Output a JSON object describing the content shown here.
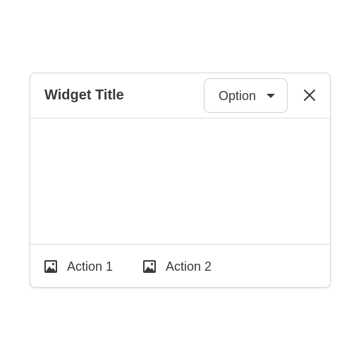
{
  "widget": {
    "title": "Widget Title",
    "option_label": "Option",
    "option_icon": "caret-down-icon",
    "close_icon": "close-icon",
    "actions": [
      {
        "label": "Action 1",
        "icon": "image-icon"
      },
      {
        "label": "Action 2",
        "icon": "image-icon"
      }
    ]
  },
  "colors": {
    "text": "#3a3a3a",
    "border": "#d9d9d9",
    "background": "#ffffff"
  }
}
